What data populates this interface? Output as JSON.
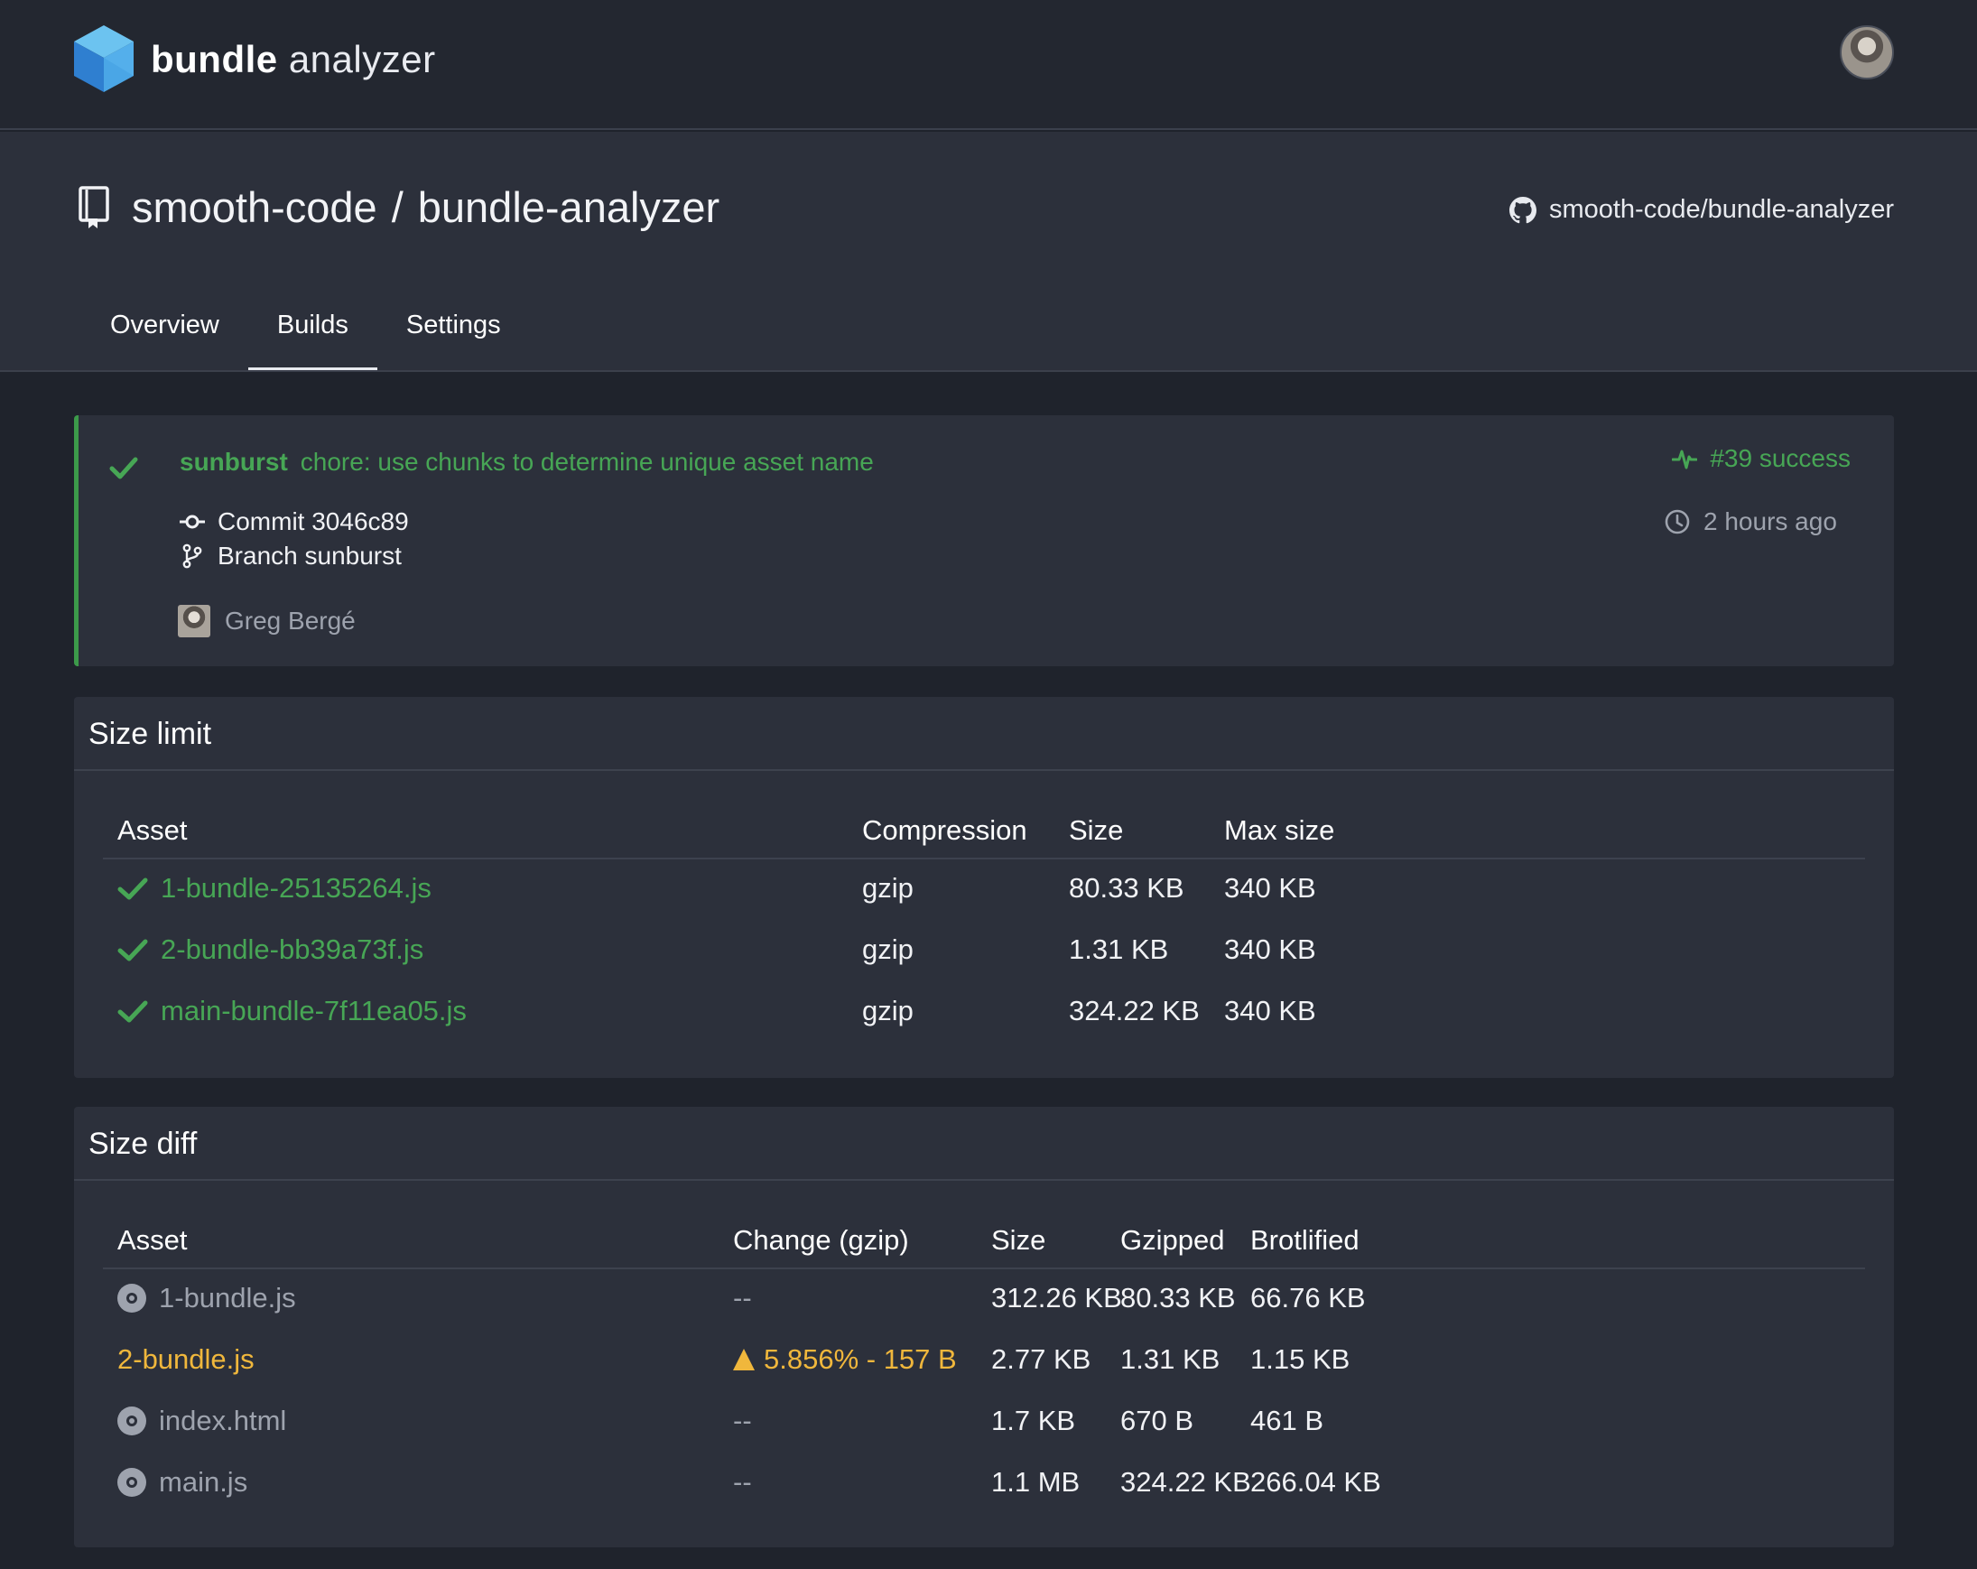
{
  "app": {
    "logo_bold": "bundle",
    "logo_light": "analyzer",
    "colors": {
      "background": "#1f232c",
      "surface": "#2c303b",
      "success": "#47a655",
      "warning": "#f0b73c",
      "muted": "#9ea3ae"
    }
  },
  "repo": {
    "owner": "smooth-code",
    "separator": "/",
    "name": "bundle-analyzer",
    "github_link": "smooth-code/bundle-analyzer"
  },
  "tabs": [
    "Overview",
    "Builds",
    "Settings"
  ],
  "active_tab": "Builds",
  "build": {
    "branch_label": "sunburst",
    "message": "chore: use chunks to determine unique asset name",
    "commit": "Commit 3046c89",
    "branch": "Branch sunburst",
    "author": "Greg Bergé",
    "status": "#39 success",
    "time": "2 hours ago"
  },
  "size_limit": {
    "title": "Size limit",
    "columns": [
      "Asset",
      "Compression",
      "Size",
      "Max size"
    ],
    "rows": [
      {
        "asset": "1-bundle-25135264.js",
        "compression": "gzip",
        "size": "80.33 KB",
        "max": "340 KB",
        "status": "pass"
      },
      {
        "asset": "2-bundle-bb39a73f.js",
        "compression": "gzip",
        "size": "1.31 KB",
        "max": "340 KB",
        "status": "pass"
      },
      {
        "asset": "main-bundle-7f11ea05.js",
        "compression": "gzip",
        "size": "324.22 KB",
        "max": "340 KB",
        "status": "pass"
      }
    ]
  },
  "size_diff": {
    "title": "Size diff",
    "columns": [
      "Asset",
      "Change (gzip)",
      "Size",
      "Gzipped",
      "Brotlified"
    ],
    "rows": [
      {
        "asset": "1-bundle.js",
        "change": "--",
        "size": "312.26 KB",
        "gzipped": "80.33 KB",
        "brotli": "66.76 KB",
        "state": "unchanged"
      },
      {
        "asset": "2-bundle.js",
        "change": "5.856% - 157 B",
        "size": "2.77 KB",
        "gzipped": "1.31 KB",
        "brotli": "1.15 KB",
        "state": "increased"
      },
      {
        "asset": "index.html",
        "change": "--",
        "size": "1.7 KB",
        "gzipped": "670 B",
        "brotli": "461 B",
        "state": "unchanged"
      },
      {
        "asset": "main.js",
        "change": "--",
        "size": "1.1 MB",
        "gzipped": "324.22 KB",
        "brotli": "266.04 KB",
        "state": "unchanged"
      }
    ]
  }
}
